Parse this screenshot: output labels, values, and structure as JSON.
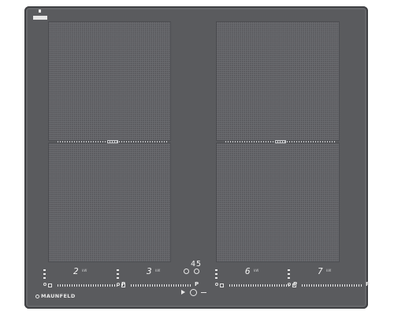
{
  "brand": {
    "name": "MAUNFELD"
  },
  "timer_display": "45",
  "zones": [
    {
      "id": "front-left",
      "power": "2",
      "unit": "kW",
      "slider_end": "P"
    },
    {
      "id": "rear-left",
      "power": "3",
      "unit": "kW",
      "slider_end": "P"
    },
    {
      "id": "front-right",
      "power": "6",
      "unit": "kW",
      "slider_end": "P"
    },
    {
      "id": "rear-right",
      "power": "7",
      "unit": "kW",
      "slider_end": "P"
    }
  ],
  "colors": {
    "glass": "#5a5b5e",
    "zone": "#6b6c70",
    "led": "#f2f2f2"
  },
  "icons": [
    "timer-icon",
    "lock-icon",
    "power-icon",
    "play-icon",
    "arrow-icon",
    "bridge-icon"
  ]
}
